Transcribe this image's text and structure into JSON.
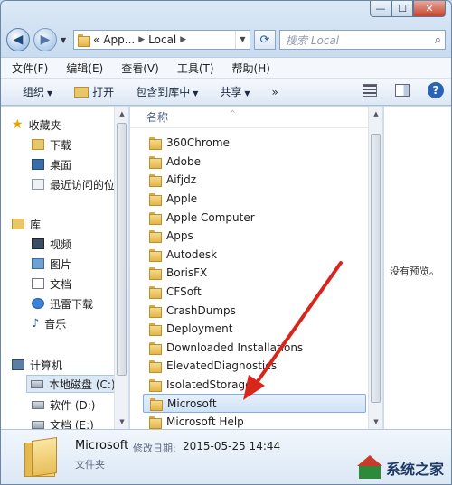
{
  "window": {
    "controls": {
      "minimize": "—",
      "maximize": "☐",
      "close": "✕"
    }
  },
  "address_bar": {
    "crumbs": [
      "«",
      "App...",
      "Local"
    ],
    "back_icon": "back-arrow-icon",
    "forward_icon": "forward-arrow-icon"
  },
  "search": {
    "placeholder": "搜索 Local"
  },
  "menu": [
    "文件(F)",
    "编辑(E)",
    "查看(V)",
    "工具(T)",
    "帮助(H)"
  ],
  "commands": {
    "organize": "组织",
    "open": "打开",
    "include_in_library": "包含到库中",
    "share": "共享",
    "more": "»"
  },
  "nav": {
    "favorites": {
      "label": "收藏夹",
      "items": [
        "下载",
        "桌面",
        "最近访问的位"
      ]
    },
    "libraries": {
      "label": "库",
      "items": [
        "视频",
        "图片",
        "文档",
        "迅雷下载",
        "音乐"
      ]
    },
    "computer": {
      "label": "计算机",
      "items": [
        "本地磁盘 (C:)",
        "软件 (D:)",
        "文档 (E:)"
      ]
    }
  },
  "content": {
    "column_name": "名称",
    "files": [
      "360Chrome",
      "Adobe",
      "Aifjdz",
      "Apple",
      "Apple Computer",
      "Apps",
      "Autodesk",
      "BorisFX",
      "CFSoft",
      "CrashDumps",
      "Deployment",
      "Downloaded Installations",
      "ElevatedDiagnostics",
      "IsolatedStorage",
      "Microsoft",
      "Microsoft Help"
    ],
    "selected": "Microsoft"
  },
  "preview": {
    "message": "没有预览。"
  },
  "details": {
    "name": "Microsoft",
    "modified_label": "修改日期:",
    "modified_value": "2015-05-25 14:44",
    "type": "文件夹"
  },
  "watermark": {
    "text": "系统之家"
  },
  "colors": {
    "window_frame": "#c8dbef",
    "selection": "#cfe2f7",
    "annotation_arrow": "#d8261c",
    "folder": "#e3b549"
  }
}
